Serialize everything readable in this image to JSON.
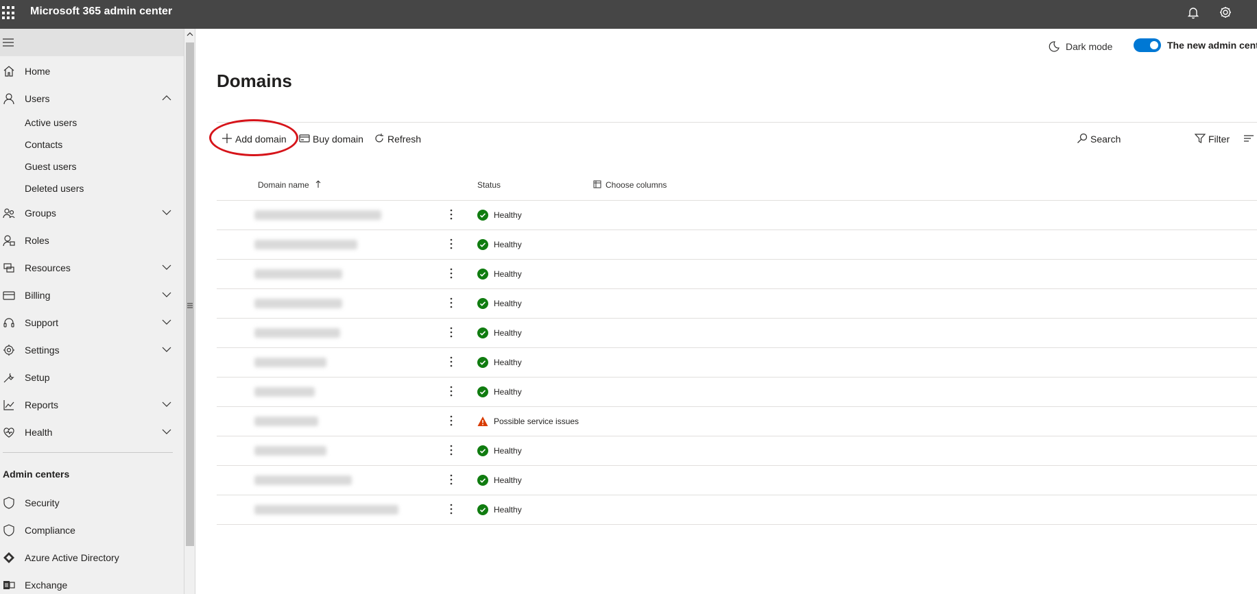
{
  "topbar": {
    "title": "Microsoft 365 admin center",
    "icons": [
      "waffle-icon",
      "bell-icon",
      "gear-icon"
    ]
  },
  "sidebar": {
    "items": [
      {
        "label": "Home",
        "icon": "home-icon"
      },
      {
        "label": "Users",
        "icon": "user-icon",
        "expanded": true
      },
      {
        "label": "Groups",
        "icon": "groups-icon"
      },
      {
        "label": "Roles",
        "icon": "roles-icon"
      },
      {
        "label": "Resources",
        "icon": "resources-icon"
      },
      {
        "label": "Billing",
        "icon": "billing-icon"
      },
      {
        "label": "Support",
        "icon": "headset-icon"
      },
      {
        "label": "Settings",
        "icon": "gear-icon"
      },
      {
        "label": "Setup",
        "icon": "wrench-icon"
      },
      {
        "label": "Reports",
        "icon": "chart-icon"
      },
      {
        "label": "Health",
        "icon": "heart-icon"
      }
    ],
    "users_sub": [
      "Active users",
      "Contacts",
      "Guest users",
      "Deleted users"
    ],
    "admin_centers_title": "Admin centers",
    "admin_centers": [
      {
        "label": "Security",
        "icon": "shield-icon"
      },
      {
        "label": "Compliance",
        "icon": "shield-icon"
      },
      {
        "label": "Azure Active Directory",
        "icon": "azure-ad-icon"
      },
      {
        "label": "Exchange",
        "icon": "exchange-icon"
      }
    ]
  },
  "header": {
    "dark_mode_label": "Dark mode",
    "new_admin_center_label": "The new admin cente",
    "toggle_on": true
  },
  "page": {
    "title": "Domains"
  },
  "toolbar": {
    "add_domain": "Add domain",
    "buy_domain": "Buy domain",
    "refresh": "Refresh",
    "search": "Search",
    "filter": "Filter"
  },
  "table": {
    "columns": {
      "domain_name": "Domain name",
      "status": "Status",
      "choose_columns": "Choose columns"
    },
    "rows": [
      {
        "status": "Healthy",
        "state": "ok"
      },
      {
        "status": "Healthy",
        "state": "ok"
      },
      {
        "status": "Healthy",
        "state": "ok"
      },
      {
        "status": "Healthy",
        "state": "ok"
      },
      {
        "status": "Healthy",
        "state": "ok"
      },
      {
        "status": "Healthy",
        "state": "ok"
      },
      {
        "status": "Healthy",
        "state": "ok"
      },
      {
        "status": "Possible service issues",
        "state": "warning"
      },
      {
        "status": "Healthy",
        "state": "ok"
      },
      {
        "status": "Healthy",
        "state": "ok"
      },
      {
        "status": "Healthy",
        "state": "ok"
      }
    ]
  },
  "colors": {
    "topbar": "#464646",
    "accent": "#0078d4",
    "healthy": "#107c10",
    "warning": "#d83b01",
    "highlight": "#d6141a"
  }
}
